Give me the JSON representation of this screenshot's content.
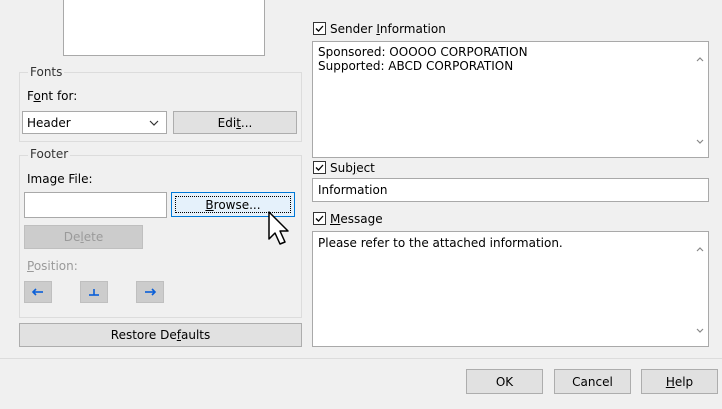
{
  "left": {
    "fonts_group": {
      "legend": "Fonts",
      "font_for_label": "Font for:",
      "font_select_value": "Header",
      "edit_button": "Edit..."
    },
    "footer_group": {
      "legend": "Footer",
      "image_file_label": "Image File:",
      "image_file_value": "",
      "browse_button": "Browse...",
      "delete_button": "Delete",
      "position_label": "Position:"
    },
    "restore_button": "Restore Defaults"
  },
  "right": {
    "sender_information": {
      "label": "Sender Information",
      "checked": true,
      "lines": [
        "Sponsored: OOOOO CORPORATION",
        "Supported: ABCD CORPORATION"
      ]
    },
    "subject": {
      "label": "Subject",
      "checked": true,
      "value": "Information"
    },
    "message": {
      "label": "Message",
      "checked": true,
      "value": "Please refer to the attached information."
    }
  },
  "dialog_buttons": {
    "ok": "OK",
    "cancel": "Cancel",
    "help": "Help"
  }
}
